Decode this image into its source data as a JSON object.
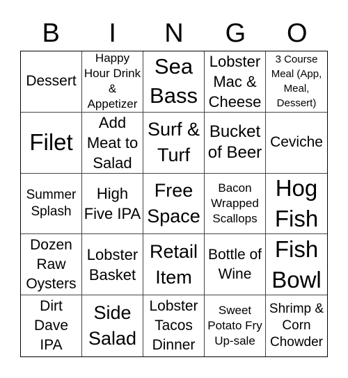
{
  "header": {
    "letters": [
      "B",
      "I",
      "N",
      "G",
      "O"
    ]
  },
  "cells": [
    {
      "label": "Dessert",
      "size": "s21"
    },
    {
      "label": "Happy Hour Drink & Appetizer",
      "size": "s17"
    },
    {
      "label": "Sea Bass",
      "size": "s31"
    },
    {
      "label": "Lobster Mac & Cheese",
      "size": "s22"
    },
    {
      "label": "3 Course Meal (App, Meal, Dessert)",
      "size": "s15"
    },
    {
      "label": "Filet",
      "size": "s33"
    },
    {
      "label": "Add Meat to Salad",
      "size": "s22"
    },
    {
      "label": "Surf & Turf",
      "size": "s27"
    },
    {
      "label": "Bucket of Beer",
      "size": "s24"
    },
    {
      "label": "Ceviche",
      "size": "s21"
    },
    {
      "label": "Summer Splash",
      "size": "s19"
    },
    {
      "label": "High Five IPA",
      "size": "s22"
    },
    {
      "label": "Free Space",
      "size": "s27"
    },
    {
      "label": "Bacon Wrapped Scallops",
      "size": "s17"
    },
    {
      "label": "Hog Fish",
      "size": "s33"
    },
    {
      "label": "Dozen Raw Oysters",
      "size": "s21"
    },
    {
      "label": "Lobster Basket",
      "size": "s22"
    },
    {
      "label": "Retail Item",
      "size": "s27"
    },
    {
      "label": "Bottle of Wine",
      "size": "s21"
    },
    {
      "label": "Fish Bowl",
      "size": "s33"
    },
    {
      "label": "Dirt Dave IPA",
      "size": "s21"
    },
    {
      "label": "Side Salad",
      "size": "s27"
    },
    {
      "label": "Lobster Tacos Dinner",
      "size": "s21"
    },
    {
      "label": "Sweet Potato Fry Up-sale",
      "size": "s17"
    },
    {
      "label": "Shrimp & Corn Chowder",
      "size": "s19"
    }
  ]
}
